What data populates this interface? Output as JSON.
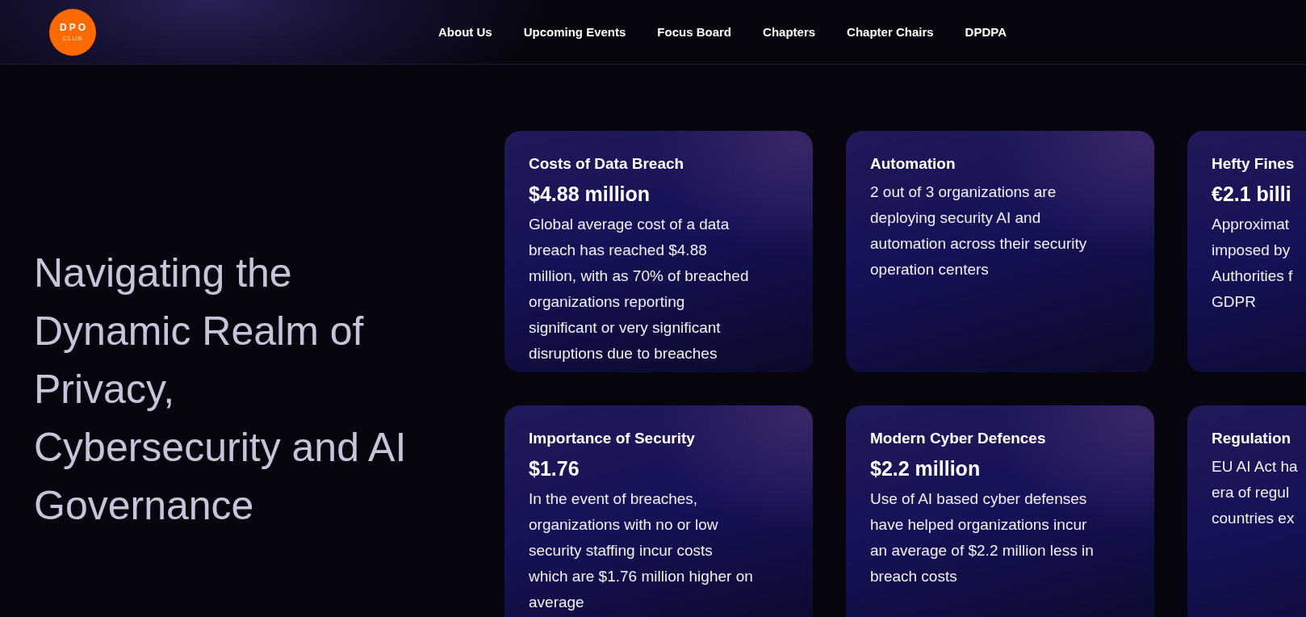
{
  "header": {
    "logo": {
      "title": "DPO",
      "subtitle": "CLUB"
    },
    "nav": [
      "About Us",
      "Upcoming Events",
      "Focus Board",
      "Chapters",
      "Chapter Chairs",
      "DPDPA"
    ]
  },
  "hero": {
    "heading": [
      "Navigating the",
      "Dynamic Realm of",
      "Privacy,",
      "Cybersecurity and AI",
      "Governance"
    ]
  },
  "cards": [
    {
      "title": "Costs of Data Breach",
      "value": "$4.88 million",
      "body": [
        "Global average cost of a data",
        "breach has reached $4.88",
        "million, with as 70% of breached",
        "organizations reporting",
        "significant or very significant",
        "disruptions due to breaches"
      ]
    },
    {
      "title": "Automation",
      "body": [
        "2 out of 3 organizations are",
        "deploying security AI and",
        "automation across their security",
        "operation centers"
      ]
    },
    {
      "title": "Hefty Fines",
      "value": "€2.1 billi",
      "body": [
        "Approximat",
        "imposed by",
        "Authorities f",
        "GDPR"
      ]
    },
    {
      "title": "Importance of Security",
      "value": "$1.76",
      "body": [
        "In the event of breaches,",
        "organizations with no or low",
        "security staffing incur costs",
        "which are $1.76 million higher on",
        "average"
      ]
    },
    {
      "title": "Modern Cyber Defences",
      "value": "$2.2 million",
      "body": [
        "Use of AI based cyber defenses",
        "have helped organizations incur",
        "an average of $2.2 million less in",
        "breach costs"
      ]
    },
    {
      "title": "Regulation",
      "body": [
        "EU AI Act ha",
        "era of regul",
        "countries ex"
      ]
    }
  ]
}
